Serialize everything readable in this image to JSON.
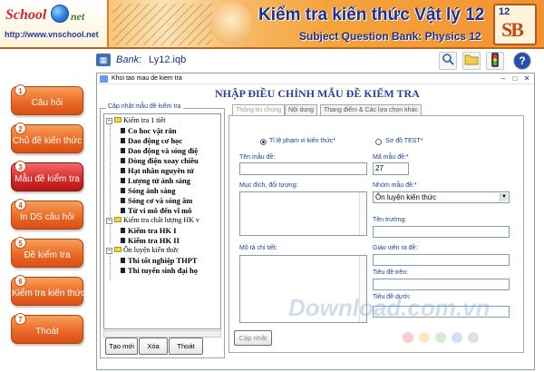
{
  "header": {
    "logo_text": "School",
    "logo_net": "net",
    "logo_url": "http://www.vnschool.net",
    "title": "Kiểm tra kiến thức Vật lý 12",
    "subtitle": "Subject Question Bank: Physics 12",
    "badge_num": "12",
    "badge_letters": "SB"
  },
  "toolbar": {
    "bank_label": "Bank:",
    "bank_file": "Ly12.iqb",
    "buttons": [
      "search-icon",
      "folder-icon",
      "traffic-light-icon",
      "help-icon"
    ],
    "help_glyph": "?"
  },
  "nav": [
    {
      "num": "1",
      "label": "Câu hỏi"
    },
    {
      "num": "2",
      "label": "Chủ đề kiến thức"
    },
    {
      "num": "3",
      "label": "Mẫu đề kiểm tra"
    },
    {
      "num": "4",
      "label": "In DS câu hỏi"
    },
    {
      "num": "5",
      "label": "Đề kiểm tra"
    },
    {
      "num": "6",
      "label": "Kiểm tra kiến thức"
    },
    {
      "num": "7",
      "label": "Thoát"
    }
  ],
  "window": {
    "title": "Khoi tao mau de kiem tra",
    "heading": "NHẬP ĐIỀU CHỈNH MẪU ĐỀ KIỂM TRA",
    "group_title": "Cập nhật mẫu đề kiểm tra",
    "tree": [
      {
        "level": 0,
        "type": "folder",
        "text": "Kiểm tra 1 tiết"
      },
      {
        "level": 1,
        "type": "leaf",
        "text": "Co hoc vật rắn"
      },
      {
        "level": 1,
        "type": "leaf",
        "text": "Dao động cơ học"
      },
      {
        "level": 1,
        "type": "leaf",
        "text": "Dao động và sóng điệ"
      },
      {
        "level": 1,
        "type": "leaf",
        "text": "Dòng điện xoay chiều"
      },
      {
        "level": 1,
        "type": "leaf",
        "text": "Hạt nhân nguyên tử"
      },
      {
        "level": 1,
        "type": "leaf",
        "text": "Lượng tử ánh sáng"
      },
      {
        "level": 1,
        "type": "leaf",
        "text": "Sóng ánh sáng"
      },
      {
        "level": 1,
        "type": "leaf",
        "text": "Sóng cơ và sóng âm"
      },
      {
        "level": 1,
        "type": "leaf",
        "text": "Từ vi mô đến vĩ mô"
      },
      {
        "level": 0,
        "type": "folder",
        "text": "Kiểm tra chất lượng HK v"
      },
      {
        "level": 1,
        "type": "leaf",
        "text": "Kiểm tra HK I"
      },
      {
        "level": 1,
        "type": "leaf",
        "text": "Kiểm tra HK II"
      },
      {
        "level": 0,
        "type": "folder",
        "text": "Ôn luyện kiến thức"
      },
      {
        "level": 1,
        "type": "leaf",
        "text": "Thi tốt nghiệp THPT"
      },
      {
        "level": 1,
        "type": "leaf",
        "text": "Thi tuyển sinh đại họ"
      }
    ],
    "buttons": {
      "new": "Tạo mới",
      "delete": "Xóa",
      "exit": "Thoát"
    },
    "tabs": [
      "Thông tin chung",
      "Nội dung",
      "Thang điểm & Các lựa chọn khác"
    ],
    "form": {
      "radio_scope": "Tỉ lệ phạm vi kiến thức*",
      "radio_test": "Sơ đồ TEST*",
      "name_label": "Tên mẫu đề:",
      "name_value": "",
      "code_label": "Mã mẫu đề:*",
      "code_value": "27",
      "purpose_label": "Mục đích, đối tượng:",
      "group_label": "Nhóm mẫu đề:*",
      "group_value": "Ôn luyện kiến thức",
      "school_label": "Tên trường:",
      "detail_label": "Mô tả chi tiết:",
      "teacher_label": "Giáo viên ra đề:",
      "top_title_label": "Tiêu đề trên:",
      "bottom_title_label": "Tiêu đề dưới:",
      "update_button": "Cập nhật"
    }
  },
  "watermark": "Download.com.vn"
}
